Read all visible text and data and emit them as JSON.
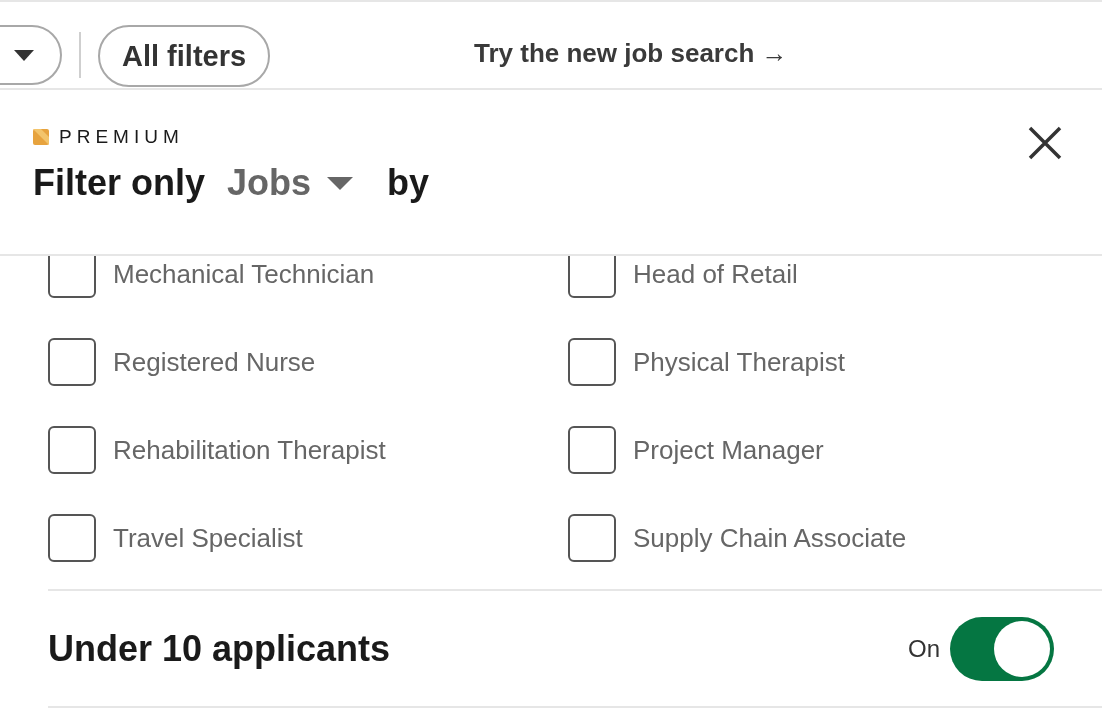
{
  "toolbar": {
    "filters_button": "All filters",
    "new_search_link": "Try the new job search →"
  },
  "panel": {
    "premium_label": "PREMIUM",
    "title_prefix": "Filter only",
    "type_dropdown": "Jobs",
    "title_suffix": "by"
  },
  "options": [
    {
      "label": "Mechanical Technician",
      "checked": false
    },
    {
      "label": "Head of Retail",
      "checked": false
    },
    {
      "label": "Registered Nurse",
      "checked": false
    },
    {
      "label": "Physical Therapist",
      "checked": false
    },
    {
      "label": "Rehabilitation Therapist",
      "checked": false
    },
    {
      "label": "Project Manager",
      "checked": false
    },
    {
      "label": "Travel Specialist",
      "checked": false
    },
    {
      "label": "Supply Chain Associate",
      "checked": false
    }
  ],
  "applicant_filter": {
    "label": "Under 10 applicants",
    "state_label": "On",
    "on": true
  }
}
